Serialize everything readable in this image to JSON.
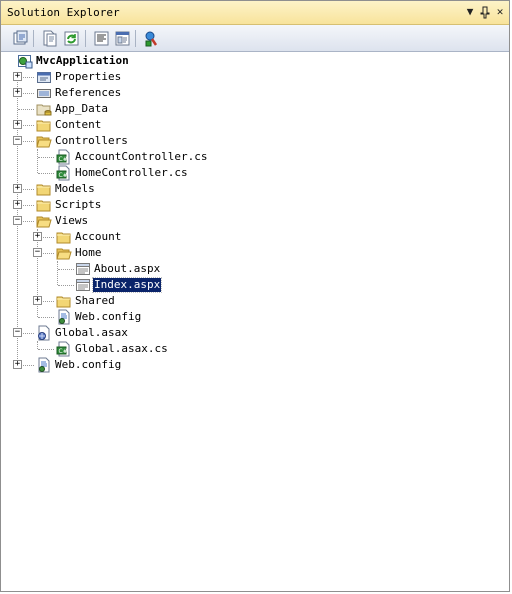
{
  "window": {
    "title": "Solution Explorer",
    "pin_glyph": "▼",
    "autohide_glyph": "ф",
    "close_glyph": "✕"
  },
  "toolbar": {
    "buttons": [
      {
        "name": "properties-icon"
      },
      {
        "name": "show-all-files-icon"
      },
      {
        "name": "refresh-icon"
      },
      {
        "name": "view-code-icon"
      },
      {
        "name": "view-designer-icon"
      },
      {
        "name": "copy-website-icon"
      }
    ]
  },
  "tree": {
    "project": "MvcApplication",
    "properties": "Properties",
    "references": "References",
    "app_data": "App_Data",
    "content": "Content",
    "controllers": "Controllers",
    "account_controller": "AccountController.cs",
    "home_controller": "HomeController.cs",
    "models": "Models",
    "scripts": "Scripts",
    "views": "Views",
    "account": "Account",
    "home": "Home",
    "about": "About.aspx",
    "index": "Index.aspx",
    "shared": "Shared",
    "views_web_config": "Web.config",
    "global_asax": "Global.asax",
    "global_asax_cs": "Global.asax.cs",
    "web_config": "Web.config"
  },
  "colors": {
    "title_bg": "#f8e39b",
    "selection": "#0a246a",
    "folder": "#e9c65a"
  }
}
